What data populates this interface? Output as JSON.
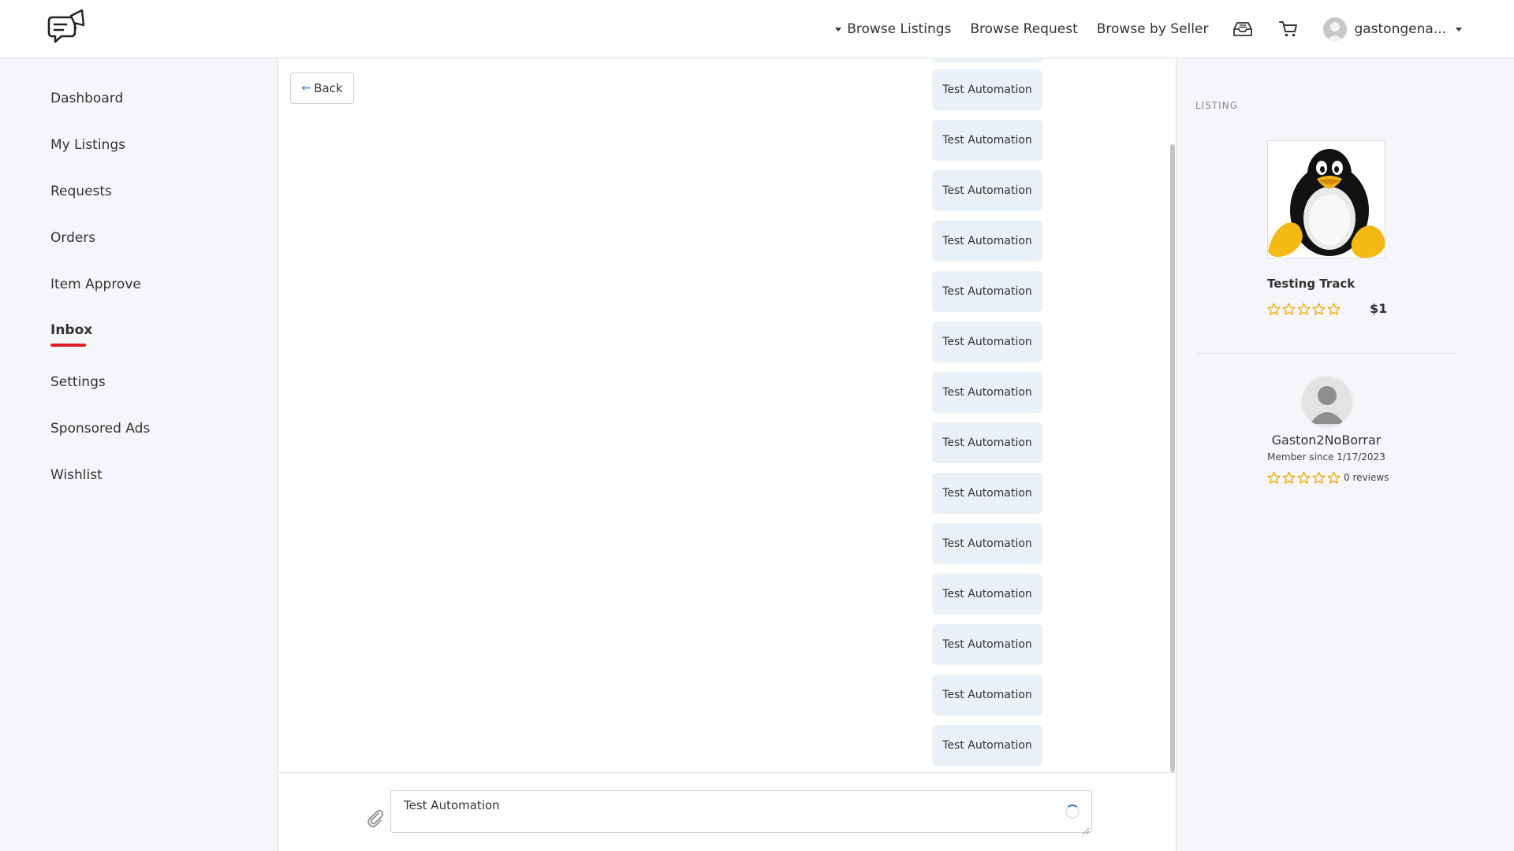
{
  "header": {
    "logo_icon": "megaphone-chat-logo-icon",
    "nav": {
      "browse_listings": "Browse Listings",
      "browse_request": "Browse Request",
      "browse_by_seller": "Browse by Seller"
    },
    "inbox_icon": "inbox-tray-icon",
    "cart_icon": "shopping-cart-icon",
    "username": "gastongena..."
  },
  "sidebar": {
    "items": [
      {
        "label": "Dashboard"
      },
      {
        "label": "My Listings"
      },
      {
        "label": "Requests"
      },
      {
        "label": "Orders"
      },
      {
        "label": "Item Approve"
      },
      {
        "label": "Inbox"
      },
      {
        "label": "Settings"
      },
      {
        "label": "Sponsored Ads"
      },
      {
        "label": "Wishlist"
      }
    ],
    "active": "Inbox",
    "accent_color": "#e01e25"
  },
  "chat": {
    "back_label": "Back",
    "messages": [
      {
        "text": "Test Automation"
      },
      {
        "text": "Test Automation"
      },
      {
        "text": "Test Automation"
      },
      {
        "text": "Test Automation"
      },
      {
        "text": "Test Automation"
      },
      {
        "text": "Test Automation"
      },
      {
        "text": "Test Automation"
      },
      {
        "text": "Test Automation"
      },
      {
        "text": "Test Automation"
      },
      {
        "text": "Test Automation"
      },
      {
        "text": "Test Automation"
      },
      {
        "text": "Test Automation"
      },
      {
        "text": "Test Automation"
      },
      {
        "text": "Test Automation"
      }
    ],
    "input_value": "Test Automation",
    "attach_icon": "paperclip-icon",
    "bubble_color": "#e9f1f7"
  },
  "listing": {
    "section_label": "LISTING",
    "title": "Testing Track",
    "price": "$1",
    "rating": 0,
    "image_icon": "penguin-image"
  },
  "seller": {
    "name": "Gaston2NoBorrar",
    "member_since": "Member since 1/17/2023",
    "reviews": "0 reviews",
    "rating": 0
  }
}
